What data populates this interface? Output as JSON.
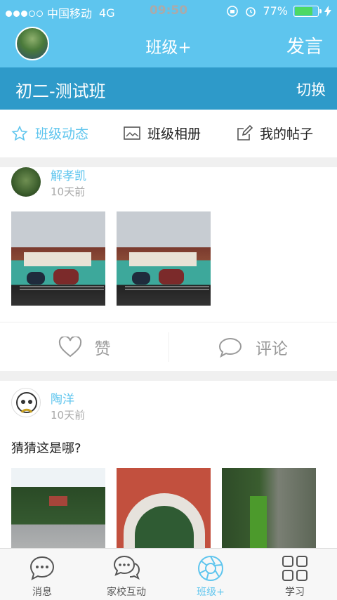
{
  "status_bar": {
    "carrier": "中国移动",
    "network": "4G",
    "time": "09:50",
    "battery": "77%",
    "battery_level": 0.77
  },
  "navbar": {
    "title": "班级+",
    "right_action": "发言"
  },
  "class_bar": {
    "class_name": "初二-测试班",
    "switch_label": "切换"
  },
  "tabs": [
    {
      "label": "班级动态",
      "icon": "star-icon",
      "active": true
    },
    {
      "label": "班级相册",
      "icon": "image-icon",
      "active": false
    },
    {
      "label": "我的帖子",
      "icon": "edit-icon",
      "active": false
    }
  ],
  "posts": [
    {
      "author": "解孝凯",
      "time": "10天前",
      "text": "",
      "actions": {
        "like": "赞",
        "comment": "评论"
      }
    },
    {
      "author": "陶洋",
      "time": "10天前",
      "text": "猜猜这是哪?"
    }
  ],
  "bottom_tabs": [
    {
      "label": "消息",
      "icon": "chat-bubble-icon"
    },
    {
      "label": "家校互动",
      "icon": "dual-chat-icon"
    },
    {
      "label": "班级+",
      "icon": "aperture-icon",
      "active": true
    },
    {
      "label": "学习",
      "icon": "grid-icon"
    }
  ],
  "colors": {
    "accent": "#5ec5ee",
    "class_bar": "#2e9ac9",
    "muted": "#999999"
  }
}
